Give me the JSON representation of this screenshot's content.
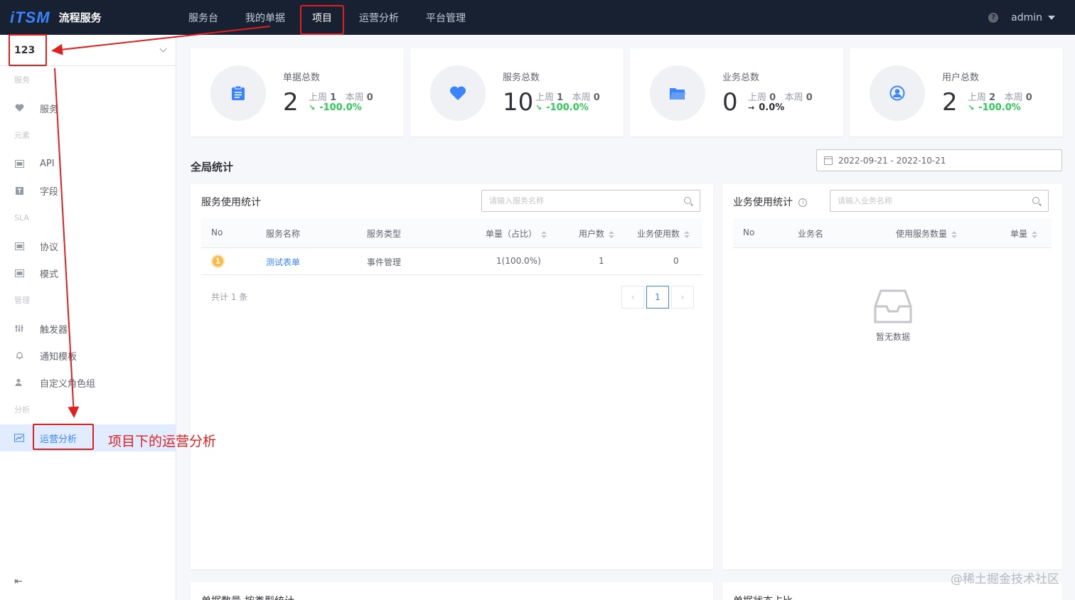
{
  "brand": {
    "logo": "iTSM",
    "name": "流程服务"
  },
  "nav": [
    "服务台",
    "我的单据",
    "项目",
    "运营分析",
    "平台管理"
  ],
  "nav_active": "项目",
  "user": {
    "name": "admin",
    "help": "?"
  },
  "sidebar": {
    "project": "123",
    "groups": {
      "service": "服务",
      "element": "元素",
      "sla": "SLA",
      "manage": "管理",
      "analysis": "分析"
    },
    "items": {
      "service": "服务",
      "api": "API",
      "field": "字段",
      "agreement": "协议",
      "mode": "模式",
      "trigger": "触发器",
      "notify": "通知模板",
      "role": "自定义角色组",
      "ops": "运营分析"
    },
    "collapse": "⇤"
  },
  "cards": [
    {
      "title": "单据总数",
      "total": "2",
      "last_label": "上周",
      "last": "1",
      "this_label": "本周",
      "this": "0",
      "trend": "-100.0%",
      "trend_icon": "arrow-down"
    },
    {
      "title": "服务总数",
      "total": "10",
      "last_label": "上周",
      "last": "1",
      "this_label": "本周",
      "this": "0",
      "trend": "-100.0%",
      "trend_icon": "arrow-down"
    },
    {
      "title": "业务总数",
      "total": "0",
      "last_label": "上周",
      "last": "0",
      "this_label": "本周",
      "this": "0",
      "trend": "0.0%",
      "trend_icon": "arrow-right"
    },
    {
      "title": "用户总数",
      "total": "2",
      "last_label": "上周",
      "last": "2",
      "this_label": "本周",
      "this": "0",
      "trend": "-100.0%",
      "trend_icon": "arrow-down"
    }
  ],
  "section_title": "全局统计",
  "date_range": "2022-09-21 - 2022-10-21",
  "service_panel": {
    "title": "服务使用统计",
    "search_placeholder": "请输入服务名称",
    "columns": [
      "No",
      "服务名称",
      "服务类型",
      "单量（占比）",
      "用户数",
      "业务使用数"
    ],
    "rows": [
      {
        "no": "1",
        "name": "测试表单",
        "type": "事件管理",
        "count": "1(100.0%)",
        "users": "1",
        "biz": "0"
      }
    ],
    "total": "共计 1 条",
    "page": "1",
    "prev": "‹",
    "next": "›"
  },
  "biz_panel": {
    "title": "业务使用统计",
    "info": "i",
    "search_placeholder": "请输入业务名称",
    "columns": [
      "No",
      "业务名",
      "使用服务数量",
      "单量"
    ],
    "empty": "暂无数据"
  },
  "bottom_panels": [
    "单据数量-按类型统计",
    "单据状态占比"
  ],
  "annotation": "项目下的运营分析",
  "watermark": "@稀土掘金技术社区",
  "colors": {
    "primary": "#3a84ff",
    "nav_bg": "#182132",
    "annotation": "#e02020",
    "trend_down": "#2dcb56"
  }
}
